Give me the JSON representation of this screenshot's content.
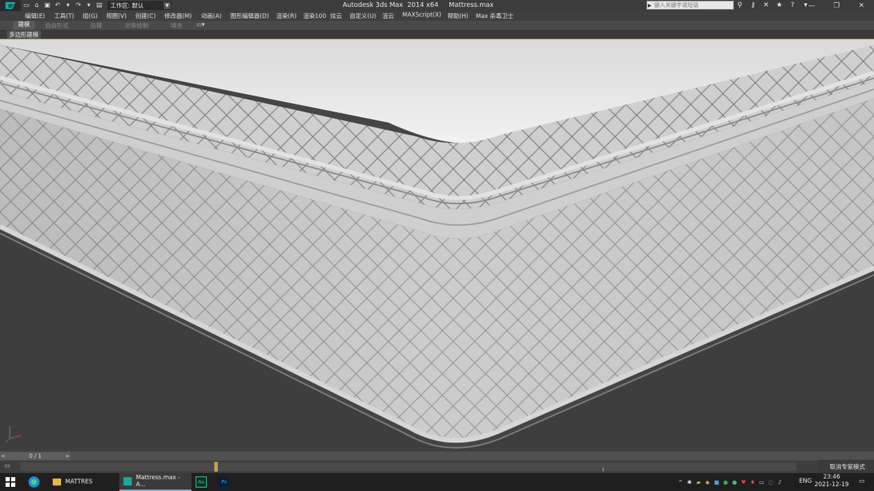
{
  "window": {
    "app_title": "Autodesk 3ds Max  2014 x64",
    "file_name": "Mattress.max",
    "search_placeholder": "键入关键字或短语",
    "workspace_label": "工作区: 默认"
  },
  "menu": {
    "items": [
      "编辑(E)",
      "工具(T)",
      "组(G)",
      "视图(V)",
      "创建(C)",
      "修改器(M)",
      "动画(A)",
      "图形编辑器(D)",
      "渲染(R)",
      "渲染100",
      "炫云",
      "自定义(U)",
      "渲云",
      "MAXScript(X)",
      "帮助(H)",
      "Max 杀毒卫士"
    ]
  },
  "ribbon": {
    "tabs": [
      "建模",
      "自由形式",
      "选择",
      "对象绘制",
      "填充"
    ],
    "active_tab": "建模",
    "sub_label": "多边形建模"
  },
  "trackbar": {
    "frame_counter": "0 / 1",
    "prev": "<",
    "next": ">"
  },
  "statusbar": {
    "expert_mode_label": "取消专家模式"
  },
  "taskbar": {
    "items": [
      {
        "label": "MATTRES"
      },
      {
        "label": "Mattress.max - A..."
      },
      {
        "label": "Au"
      },
      {
        "label": "Ps"
      }
    ],
    "language": "ENG",
    "time": "23:46",
    "date": "2021-12-19"
  },
  "colors": {
    "viewport_bg": "#454545",
    "timeline_key": "#c8a040",
    "taskbar_accent": "#76b9ed"
  }
}
